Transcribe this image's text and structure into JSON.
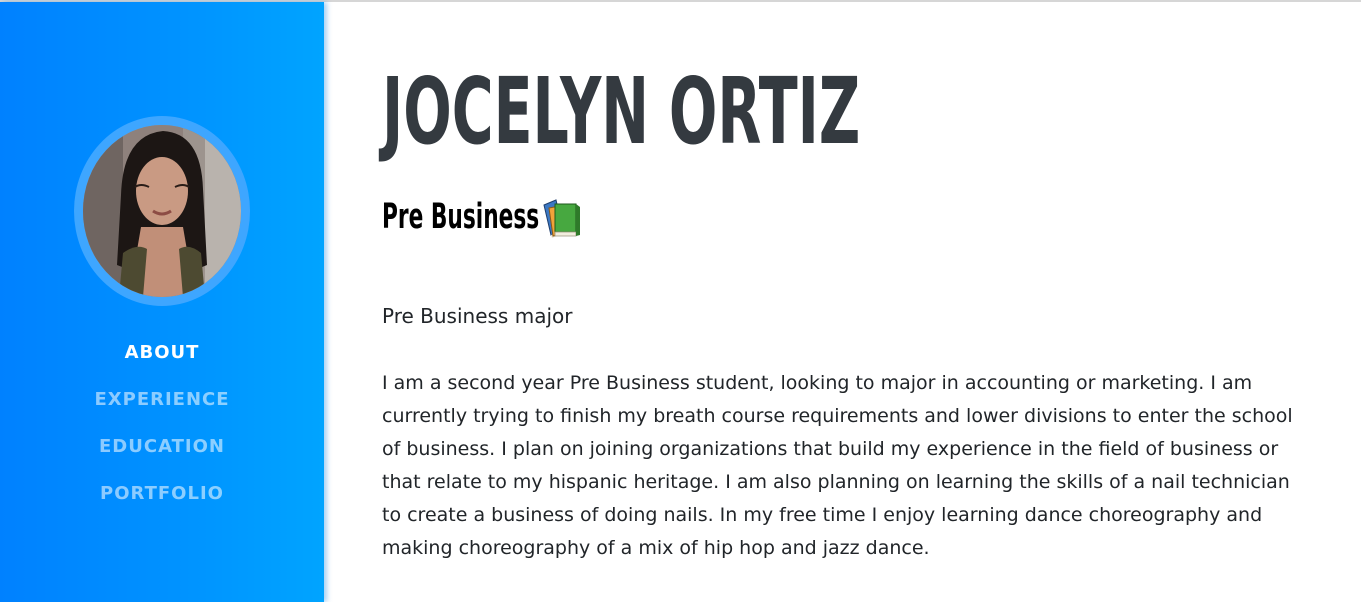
{
  "profile": {
    "name": "JOCELYN ORTIZ",
    "subtitle": "Pre Business",
    "subtitle_icon": "books-icon",
    "major": "Pre Business major",
    "bio": "I am a second year Pre Business student, looking to major in accounting or marketing. I am currently trying to finish my breath course requirements and lower divisions to enter the school of business. I plan on joining organizations that build my experience in the field of business or that relate to my hispanic heritage. I am also planning on learning the skills of a nail technician to create a business of doing nails. In my free time I enjoy learning dance choreography and making choreography of a mix of hip hop and jazz dance."
  },
  "sidebar": {
    "nav": [
      {
        "label": "ABOUT",
        "active": true
      },
      {
        "label": "EXPERIENCE",
        "active": false
      },
      {
        "label": "EDUCATION",
        "active": false
      },
      {
        "label": "PORTFOLIO",
        "active": false
      }
    ]
  },
  "colors": {
    "sidebar_gradient_start": "#0081ff",
    "sidebar_gradient_end": "#00a4ff",
    "avatar_ring": "#3ea6ff",
    "heading": "#343a40",
    "body_text": "#212529"
  }
}
